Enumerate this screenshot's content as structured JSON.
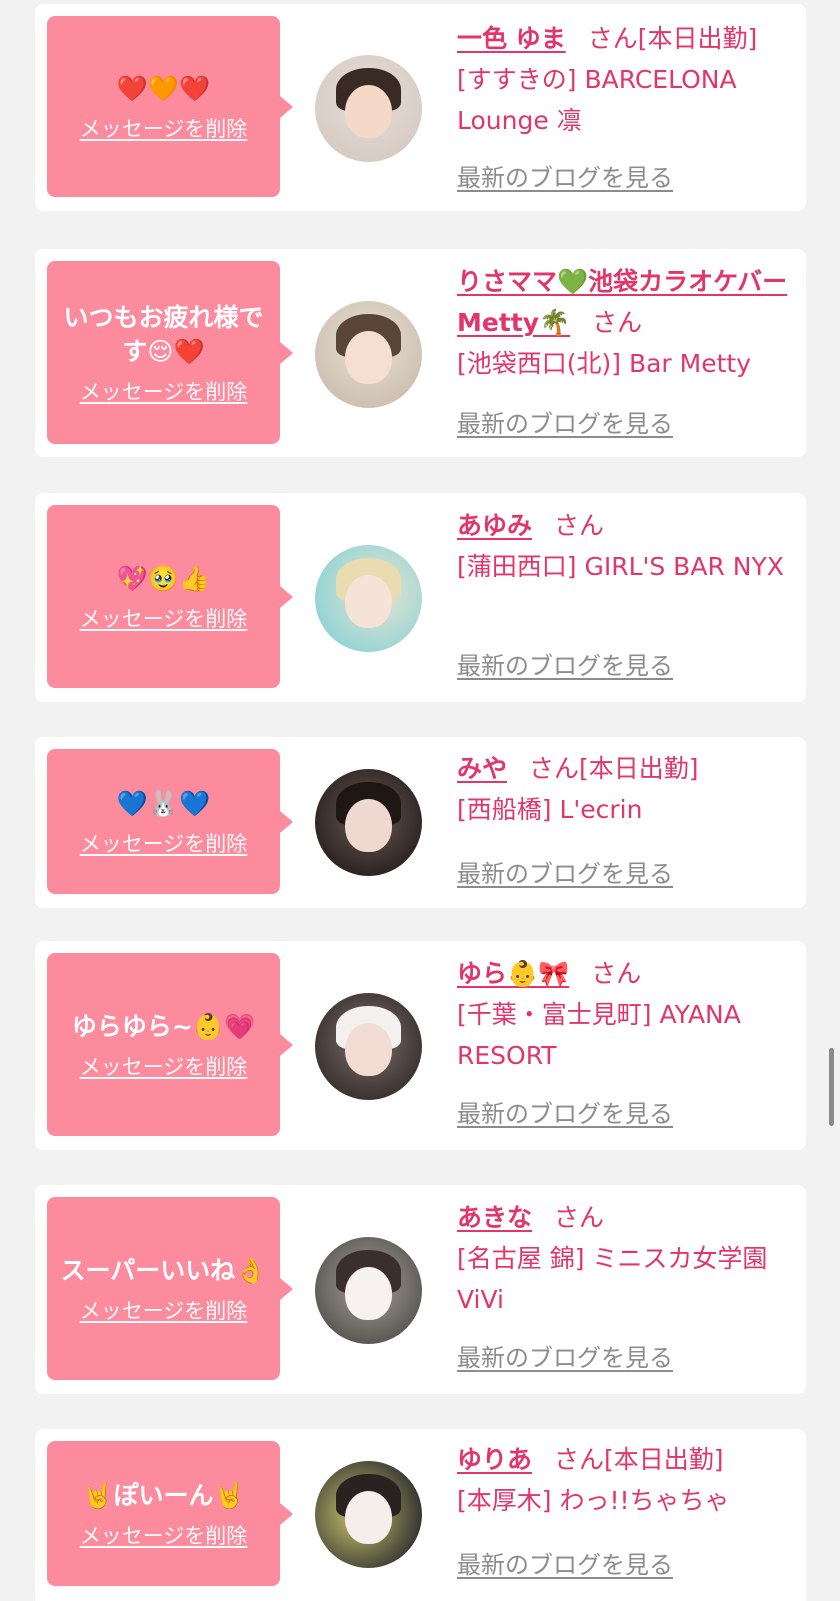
{
  "delete_label": "メッセージを削除",
  "san_label": "さん",
  "blog_label": "最新のブログを見る",
  "colors": {
    "background": "#f2f2f2",
    "card": "#ffffff",
    "bubble": "#fc8b9d",
    "accent": "#e2366b",
    "blog_link": "#8c8c8c"
  },
  "cards": [
    {
      "message": "❤️🧡❤️",
      "name": "一色 ゆま",
      "status": "[本日出勤]",
      "shop": "[すすきの] BARCELONA Lounge 凛",
      "avatar_icon": "woman-portrait"
    },
    {
      "message": "いつもお疲れ様です😌❤️",
      "name": "りさママ💚池袋カラオケバーMetty🌴",
      "status": "",
      "shop": "[池袋西口(北)] Bar Metty",
      "avatar_icon": "woman-portrait"
    },
    {
      "message": "💖🥹👍",
      "name": "あゆみ",
      "status": "",
      "shop": "[蒲田西口] GIRL'S BAR NYX",
      "avatar_icon": "woman-portrait"
    },
    {
      "message": "💙🐰💙",
      "name": "みや",
      "status": "[本日出勤]",
      "shop": "[西船橋] L'ecrin",
      "avatar_icon": "woman-portrait"
    },
    {
      "message": "ゆらゆら~👶💗",
      "name": "ゆら👶🎀",
      "status": "",
      "shop": "[千葉・富士見町] AYANA RESORT",
      "avatar_icon": "woman-portrait"
    },
    {
      "message": "スーパーいいね👌",
      "name": "あきな",
      "status": "",
      "shop": "[名古屋 錦] ミニスカ女学園ViVi",
      "avatar_icon": "woman-portrait"
    },
    {
      "message": "🤘ぽいーん🤘",
      "name": "ゆりあ",
      "status": "[本日出勤]",
      "shop": "[本厚木] わっ!!ちゃちゃ",
      "avatar_icon": "woman-portrait"
    }
  ]
}
